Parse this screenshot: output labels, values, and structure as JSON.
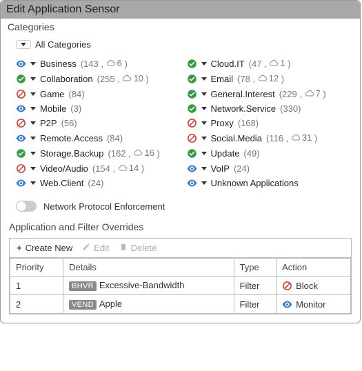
{
  "title": "Edit Application Sensor",
  "categories_label": "Categories",
  "all_categories_label": "All Categories",
  "categories": [
    {
      "name": "Business",
      "count": 143,
      "cloud": 6,
      "status": "monitor"
    },
    {
      "name": "Cloud.IT",
      "count": 47,
      "cloud": 1,
      "status": "allow"
    },
    {
      "name": "Collaboration",
      "count": 255,
      "cloud": 10,
      "status": "allow"
    },
    {
      "name": "Email",
      "count": 78,
      "cloud": 12,
      "status": "allow"
    },
    {
      "name": "Game",
      "count": 84,
      "cloud": null,
      "status": "block"
    },
    {
      "name": "General.Interest",
      "count": 229,
      "cloud": 7,
      "status": "allow"
    },
    {
      "name": "Mobile",
      "count": 3,
      "cloud": null,
      "status": "monitor"
    },
    {
      "name": "Network.Service",
      "count": 330,
      "cloud": null,
      "status": "allow"
    },
    {
      "name": "P2P",
      "count": 56,
      "cloud": null,
      "status": "block"
    },
    {
      "name": "Proxy",
      "count": 168,
      "cloud": null,
      "status": "block"
    },
    {
      "name": "Remote.Access",
      "count": 84,
      "cloud": null,
      "status": "monitor"
    },
    {
      "name": "Social.Media",
      "count": 116,
      "cloud": 31,
      "status": "block"
    },
    {
      "name": "Storage.Backup",
      "count": 162,
      "cloud": 16,
      "status": "allow"
    },
    {
      "name": "Update",
      "count": 49,
      "cloud": null,
      "status": "allow"
    },
    {
      "name": "Video/Audio",
      "count": 154,
      "cloud": 14,
      "status": "block"
    },
    {
      "name": "VoIP",
      "count": 24,
      "cloud": null,
      "status": "monitor"
    },
    {
      "name": "Web.Client",
      "count": 24,
      "cloud": null,
      "status": "monitor"
    },
    {
      "name": "Unknown Applications",
      "count": null,
      "cloud": null,
      "status": "monitor"
    }
  ],
  "network_protocol_enforcement": {
    "label": "Network Protocol Enforcement",
    "enabled": false
  },
  "overrides_label": "Application and Filter Overrides",
  "toolbar": {
    "create_new": "Create New",
    "edit": "Edit",
    "delete": "Delete"
  },
  "table": {
    "headers": {
      "priority": "Priority",
      "details": "Details",
      "type": "Type",
      "action": "Action"
    },
    "rows": [
      {
        "priority": "1",
        "tag": "BHVR",
        "detail": "Excessive-Bandwidth",
        "type": "Filter",
        "action": "Block",
        "action_icon": "block"
      },
      {
        "priority": "2",
        "tag": "VEND",
        "detail": "Apple",
        "type": "Filter",
        "action": "Monitor",
        "action_icon": "monitor"
      }
    ]
  },
  "icons": {
    "monitor_color": "#2e7bd6",
    "allow_color": "#2e9e3f",
    "block_color": "#d63a2e"
  }
}
